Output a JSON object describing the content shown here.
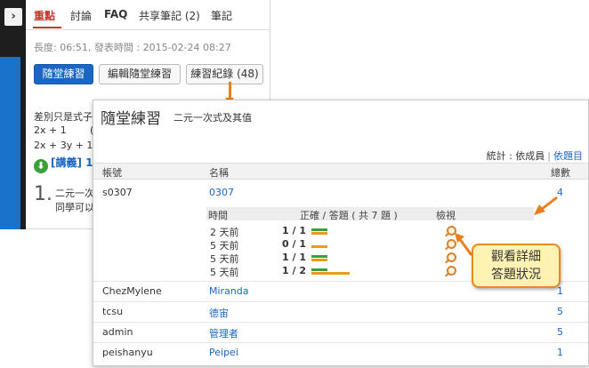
{
  "bg": {
    "tabs": [
      "重點",
      "討論",
      "FAQ",
      "共享筆記 (2)",
      "筆記"
    ],
    "meta": "長度: 06:51, 發表時間 : 2015-02-24 08:27",
    "buttons": {
      "practice": "隨堂練習",
      "edit": "編輯隨堂練習",
      "records": "練習紀錄 (48)"
    },
    "lines": [
      "差別只是式子",
      "2x + 1",
      "(",
      "2x + 3y + 1 (",
      "[講義] 1"
    ],
    "question_number": "1.",
    "question_lines": [
      "二元一次",
      "同學可以"
    ]
  },
  "popup": {
    "title": "隨堂練習",
    "subtitle": "二元一次式及其值",
    "stats_label": "統計 : 依成員",
    "stats_sep": "|",
    "stats_link": "依題目",
    "columns": [
      "帳號",
      "名稱",
      "總數"
    ],
    "rows": [
      {
        "account": "s0307",
        "name": "0307",
        "total": "4"
      },
      {
        "account": "ChezMylene",
        "name": "Miranda",
        "total": "1"
      },
      {
        "account": "tcsu",
        "name": "德宙",
        "total": "5"
      },
      {
        "account": "admin",
        "name": "管理者",
        "total": "5"
      },
      {
        "account": "peishanyu",
        "name": "Peipei",
        "total": "1"
      }
    ],
    "detail": {
      "headers": [
        "時間",
        "正確 / 答題 ( 共 7 題 )",
        "檢視"
      ],
      "rows": [
        {
          "time": "2 天前",
          "score": "1 / 1",
          "correct": 1,
          "answered": 1
        },
        {
          "time": "5 天前",
          "score": "0 / 1",
          "correct": 0,
          "answered": 1
        },
        {
          "time": "5 天前",
          "score": "1 / 1",
          "correct": 1,
          "answered": 1
        },
        {
          "time": "5 天前",
          "score": "1 / 2",
          "correct": 1,
          "answered": 2
        }
      ]
    }
  },
  "callout": {
    "line1": "觀看詳細",
    "line2": "答題狀況"
  },
  "colors": {
    "accent": "#e87f1c",
    "link": "#1a66c2",
    "correct": "#3aa03a",
    "answered": "#e89a1c"
  }
}
